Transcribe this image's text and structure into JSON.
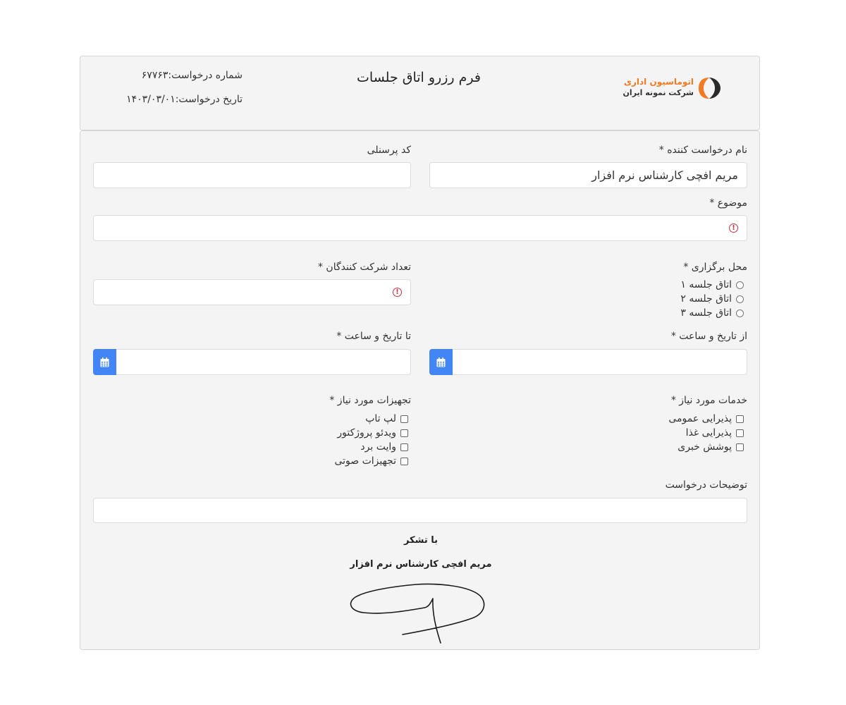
{
  "header": {
    "title": "فرم رزرو اتاق جلسات",
    "request_number": "شماره درخواست:۶۷۷۶۳",
    "request_date": "تاریخ درخواست:۱۴۰۳/۰۳/۰۱",
    "logo": {
      "line1": "اتوماسیون اداری",
      "line2": "شرکت نمونه ایران",
      "accent": "#f07b22"
    }
  },
  "form": {
    "requester_label": "نام درخواست کننده *",
    "requester_value": "مریم افچی کارشناس نرم افزار",
    "personnel_code_label": "کد پرسنلی",
    "personnel_code_value": "",
    "subject_label": "موضوع *",
    "subject_value": "",
    "location_label": "محل برگزاری *",
    "location_options": [
      "اتاق جلسه ۱",
      "اتاق جلسه ۲",
      "اتاق جلسه ۳"
    ],
    "participants_label": "تعداد شرکت کنندگان *",
    "participants_value": "",
    "from_label": "از تاریخ و ساعت *",
    "to_label": "تا تاریخ و ساعت *",
    "services_label": "خدمات مورد نیاز *",
    "services_options": [
      "پذیرایی عمومی",
      "پذیرایی غذا",
      "پوشش خبری"
    ],
    "equipment_label": "تجهیزات مورد نیاز *",
    "equipment_options": [
      "لپ تاپ",
      "ویدئو پروژکتور",
      "وایت برد",
      "تجهیزات صوتی"
    ],
    "description_label": "توضیحات درخواست",
    "description_value": ""
  },
  "footer": {
    "thanks": "با تشکر",
    "signer": "مریم افچی کارشناس نرم افزار"
  },
  "colors": {
    "accent_button": "#4285f4",
    "error": "#d0313b"
  },
  "icons": {
    "calendar": "calendar-icon",
    "error": "exclamation-circle-icon"
  }
}
